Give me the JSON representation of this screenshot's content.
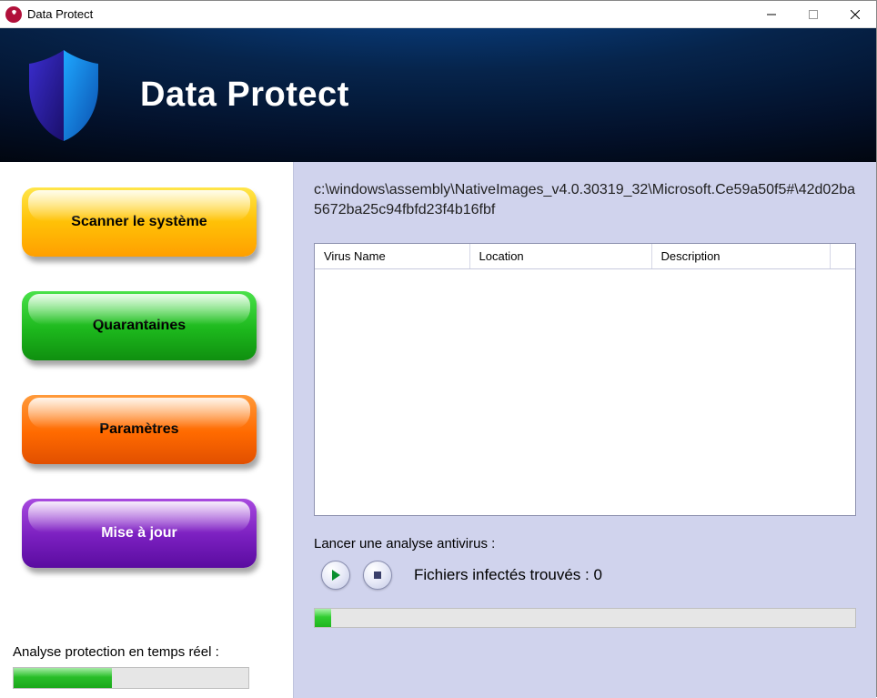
{
  "window": {
    "title": "Data Protect",
    "app_name": "Data Protect"
  },
  "sidebar": {
    "scan": "Scanner le système",
    "quarantine": "Quarantaines",
    "settings": "Paramètres",
    "update": "Mise à jour",
    "realtime_label": "Analyse protection en temps réel :",
    "realtime_progress_pct": 42
  },
  "main": {
    "current_path": "c:\\windows\\assembly\\NativeImages_v4.0.30319_32\\Microsoft.Ce59a50f5#\\42d02ba5672ba25c94fbfd23f4b16fbf",
    "table": {
      "headers": {
        "virus": "Virus Name",
        "location": "Location",
        "description": "Description"
      },
      "rows": []
    },
    "launch_label": "Lancer une analyse antivirus :",
    "infected_label": "Fichiers infectés trouvés : 0",
    "scan_progress_pct": 3
  },
  "colors": {
    "panel_bg": "#d0d3ed",
    "scan_btn": "#ffc107",
    "quarantine_btn": "#1db81d",
    "settings_btn": "#ff6a00",
    "update_btn": "#7a1fbf"
  }
}
